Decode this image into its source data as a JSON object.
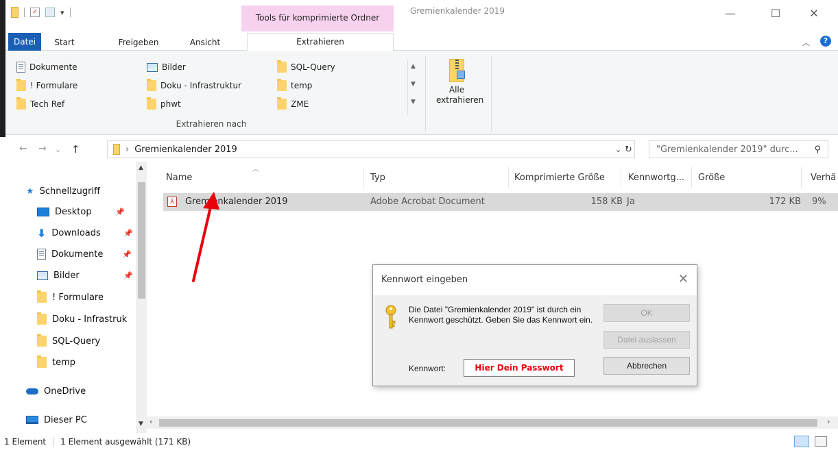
{
  "window": {
    "title": "Gremienkalender 2019",
    "context_tab_group": "Tools für komprimierte Ordner",
    "minimize": "—",
    "maximize": "☐",
    "close": "✕"
  },
  "ribbon_tabs": [
    "Datei",
    "Start",
    "Freigeben",
    "Ansicht",
    "Extrahieren"
  ],
  "ribbon": {
    "extract_to_items": [
      "Dokumente",
      "Bilder",
      "SQL-Query",
      "! Formulare",
      "Doku - Infrastruktur",
      "temp",
      "Tech Ref",
      "phwt",
      "ZME"
    ],
    "group_label": "Extrahieren nach",
    "extract_all": "Alle extrahieren"
  },
  "address": {
    "path": "Gremienkalender 2019",
    "search_placeholder": "\"Gremienkalender 2019\" durc..."
  },
  "nav": {
    "quick_access": "Schnellzugriff",
    "items": [
      "Desktop",
      "Downloads",
      "Dokumente",
      "Bilder",
      "! Formulare",
      "Doku - Infrastruk",
      "SQL-Query",
      "temp"
    ],
    "onedrive": "OneDrive",
    "this_pc": "Dieser PC"
  },
  "columns": [
    "Name",
    "Typ",
    "Komprimierte Größe",
    "Kennwortg...",
    "Größe",
    "Verhä"
  ],
  "files": [
    {
      "name": "Gremienkalender 2019",
      "type": "Adobe Acrobat Document",
      "compressed": "158 KB",
      "password": "Ja",
      "size": "172 KB",
      "ratio": "9%"
    }
  ],
  "status": {
    "count": "1 Element",
    "selected": "1 Element ausgewählt (171 KB)"
  },
  "dialog": {
    "title": "Kennwort eingeben",
    "message": "Die Datei \"Gremienkalender 2019\" ist durch ein Kennwort geschützt. Geben Sie das Kennwort ein.",
    "ok": "OK",
    "skip": "Datei auslassen",
    "cancel": "Abbrechen",
    "password_label": "Kennwort:",
    "password_value": "Hier Dein Passwort"
  },
  "colors": {
    "file_tab": "#1a5fb4",
    "context_tab": "#f7d2ee",
    "selection": "#d9d9d9",
    "arrow": "#e8000b"
  }
}
